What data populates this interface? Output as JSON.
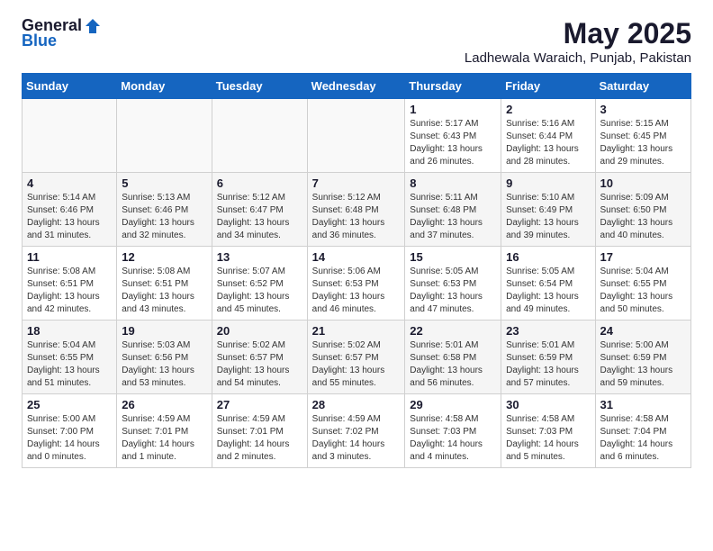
{
  "header": {
    "logo_general": "General",
    "logo_blue": "Blue",
    "month_year": "May 2025",
    "location": "Ladhewala Waraich, Punjab, Pakistan"
  },
  "days_of_week": [
    "Sunday",
    "Monday",
    "Tuesday",
    "Wednesday",
    "Thursday",
    "Friday",
    "Saturday"
  ],
  "weeks": [
    [
      {
        "day": "",
        "text": ""
      },
      {
        "day": "",
        "text": ""
      },
      {
        "day": "",
        "text": ""
      },
      {
        "day": "",
        "text": ""
      },
      {
        "day": "1",
        "text": "Sunrise: 5:17 AM\nSunset: 6:43 PM\nDaylight: 13 hours\nand 26 minutes."
      },
      {
        "day": "2",
        "text": "Sunrise: 5:16 AM\nSunset: 6:44 PM\nDaylight: 13 hours\nand 28 minutes."
      },
      {
        "day": "3",
        "text": "Sunrise: 5:15 AM\nSunset: 6:45 PM\nDaylight: 13 hours\nand 29 minutes."
      }
    ],
    [
      {
        "day": "4",
        "text": "Sunrise: 5:14 AM\nSunset: 6:46 PM\nDaylight: 13 hours\nand 31 minutes."
      },
      {
        "day": "5",
        "text": "Sunrise: 5:13 AM\nSunset: 6:46 PM\nDaylight: 13 hours\nand 32 minutes."
      },
      {
        "day": "6",
        "text": "Sunrise: 5:12 AM\nSunset: 6:47 PM\nDaylight: 13 hours\nand 34 minutes."
      },
      {
        "day": "7",
        "text": "Sunrise: 5:12 AM\nSunset: 6:48 PM\nDaylight: 13 hours\nand 36 minutes."
      },
      {
        "day": "8",
        "text": "Sunrise: 5:11 AM\nSunset: 6:48 PM\nDaylight: 13 hours\nand 37 minutes."
      },
      {
        "day": "9",
        "text": "Sunrise: 5:10 AM\nSunset: 6:49 PM\nDaylight: 13 hours\nand 39 minutes."
      },
      {
        "day": "10",
        "text": "Sunrise: 5:09 AM\nSunset: 6:50 PM\nDaylight: 13 hours\nand 40 minutes."
      }
    ],
    [
      {
        "day": "11",
        "text": "Sunrise: 5:08 AM\nSunset: 6:51 PM\nDaylight: 13 hours\nand 42 minutes."
      },
      {
        "day": "12",
        "text": "Sunrise: 5:08 AM\nSunset: 6:51 PM\nDaylight: 13 hours\nand 43 minutes."
      },
      {
        "day": "13",
        "text": "Sunrise: 5:07 AM\nSunset: 6:52 PM\nDaylight: 13 hours\nand 45 minutes."
      },
      {
        "day": "14",
        "text": "Sunrise: 5:06 AM\nSunset: 6:53 PM\nDaylight: 13 hours\nand 46 minutes."
      },
      {
        "day": "15",
        "text": "Sunrise: 5:05 AM\nSunset: 6:53 PM\nDaylight: 13 hours\nand 47 minutes."
      },
      {
        "day": "16",
        "text": "Sunrise: 5:05 AM\nSunset: 6:54 PM\nDaylight: 13 hours\nand 49 minutes."
      },
      {
        "day": "17",
        "text": "Sunrise: 5:04 AM\nSunset: 6:55 PM\nDaylight: 13 hours\nand 50 minutes."
      }
    ],
    [
      {
        "day": "18",
        "text": "Sunrise: 5:04 AM\nSunset: 6:55 PM\nDaylight: 13 hours\nand 51 minutes."
      },
      {
        "day": "19",
        "text": "Sunrise: 5:03 AM\nSunset: 6:56 PM\nDaylight: 13 hours\nand 53 minutes."
      },
      {
        "day": "20",
        "text": "Sunrise: 5:02 AM\nSunset: 6:57 PM\nDaylight: 13 hours\nand 54 minutes."
      },
      {
        "day": "21",
        "text": "Sunrise: 5:02 AM\nSunset: 6:57 PM\nDaylight: 13 hours\nand 55 minutes."
      },
      {
        "day": "22",
        "text": "Sunrise: 5:01 AM\nSunset: 6:58 PM\nDaylight: 13 hours\nand 56 minutes."
      },
      {
        "day": "23",
        "text": "Sunrise: 5:01 AM\nSunset: 6:59 PM\nDaylight: 13 hours\nand 57 minutes."
      },
      {
        "day": "24",
        "text": "Sunrise: 5:00 AM\nSunset: 6:59 PM\nDaylight: 13 hours\nand 59 minutes."
      }
    ],
    [
      {
        "day": "25",
        "text": "Sunrise: 5:00 AM\nSunset: 7:00 PM\nDaylight: 14 hours\nand 0 minutes."
      },
      {
        "day": "26",
        "text": "Sunrise: 4:59 AM\nSunset: 7:01 PM\nDaylight: 14 hours\nand 1 minute."
      },
      {
        "day": "27",
        "text": "Sunrise: 4:59 AM\nSunset: 7:01 PM\nDaylight: 14 hours\nand 2 minutes."
      },
      {
        "day": "28",
        "text": "Sunrise: 4:59 AM\nSunset: 7:02 PM\nDaylight: 14 hours\nand 3 minutes."
      },
      {
        "day": "29",
        "text": "Sunrise: 4:58 AM\nSunset: 7:03 PM\nDaylight: 14 hours\nand 4 minutes."
      },
      {
        "day": "30",
        "text": "Sunrise: 4:58 AM\nSunset: 7:03 PM\nDaylight: 14 hours\nand 5 minutes."
      },
      {
        "day": "31",
        "text": "Sunrise: 4:58 AM\nSunset: 7:04 PM\nDaylight: 14 hours\nand 6 minutes."
      }
    ]
  ]
}
